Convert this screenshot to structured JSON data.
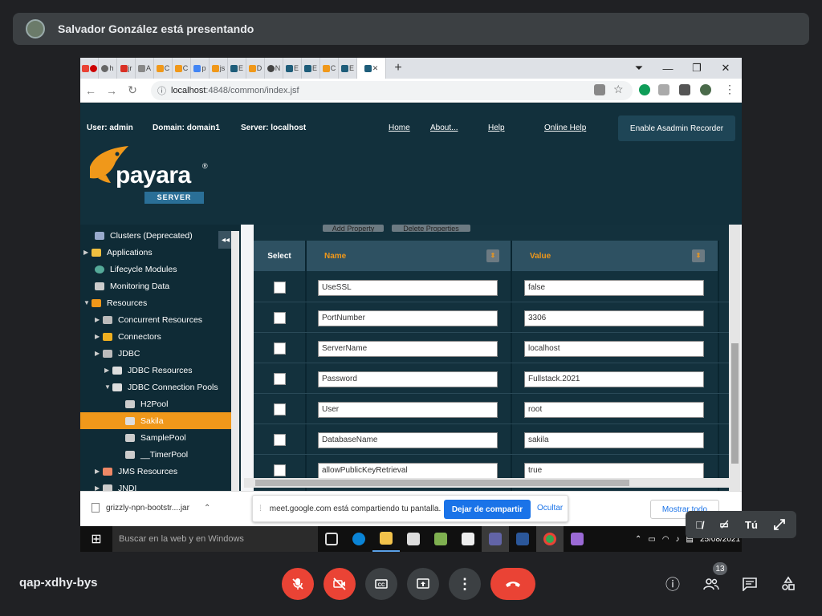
{
  "meet": {
    "presenter_text": "Salvador González está presentando",
    "meeting_code": "qap-xdhy-bys",
    "self_label": "Tú",
    "participant_count": "13"
  },
  "browser": {
    "tabs": [
      "h",
      "jr",
      "A",
      "C",
      "C",
      "p",
      "js",
      "E",
      "D",
      "N",
      "E",
      "E",
      "C",
      "E"
    ],
    "address_host": "localhost",
    "address_rest": ":4848/common/index.jsf"
  },
  "payara": {
    "user": "User: admin",
    "domain": "Domain: domain1",
    "server": "Server: localhost",
    "links": {
      "home": "Home",
      "about": "About...",
      "help": "Help",
      "online_help": "Online Help"
    },
    "recorder_button": "Enable Asadmin Recorder",
    "logo_word": "payara",
    "logo_sub": "SERVER"
  },
  "tree": [
    {
      "label": "Clusters (Deprecated)"
    },
    {
      "label": "Applications"
    },
    {
      "label": "Lifecycle Modules"
    },
    {
      "label": "Monitoring Data"
    },
    {
      "label": "Resources"
    },
    {
      "label": "Concurrent Resources"
    },
    {
      "label": "Connectors"
    },
    {
      "label": "JDBC"
    },
    {
      "label": "JDBC Resources"
    },
    {
      "label": "JDBC Connection Pools"
    },
    {
      "label": "H2Pool"
    },
    {
      "label": "Sakila"
    },
    {
      "label": "SamplePool"
    },
    {
      "label": "__TimerPool"
    },
    {
      "label": "JMS Resources"
    },
    {
      "label": "JNDI"
    }
  ],
  "table": {
    "buttons": {
      "add": "Add Property",
      "delete": "Delete Properties"
    },
    "headers": {
      "select": "Select",
      "name": "Name",
      "value": "Value"
    },
    "rows": [
      {
        "name": "UseSSL",
        "value": "false"
      },
      {
        "name": "PortNumber",
        "value": "3306"
      },
      {
        "name": "ServerName",
        "value": "localhost"
      },
      {
        "name": "Password",
        "value": "Fullstack.2021"
      },
      {
        "name": "User",
        "value": "root"
      },
      {
        "name": "DatabaseName",
        "value": "sakila"
      },
      {
        "name": "allowPublicKeyRetrieval",
        "value": "true"
      }
    ]
  },
  "download": {
    "file": "grizzly-npn-bootstr....jar"
  },
  "share_notice": {
    "text": "meet.google.com está compartiendo tu pantalla.",
    "stop": "Dejar de compartir",
    "hide": "Ocultar"
  },
  "show_all": "Mostrar todo",
  "taskbar": {
    "search": "Buscar en la web y en Windows",
    "date": "25/08/2021"
  },
  "colors": {
    "meet_red": "#ea4335",
    "payara_orange": "#f0981a",
    "payara_bg": "#13313d",
    "share_blue": "#1a73e8"
  }
}
